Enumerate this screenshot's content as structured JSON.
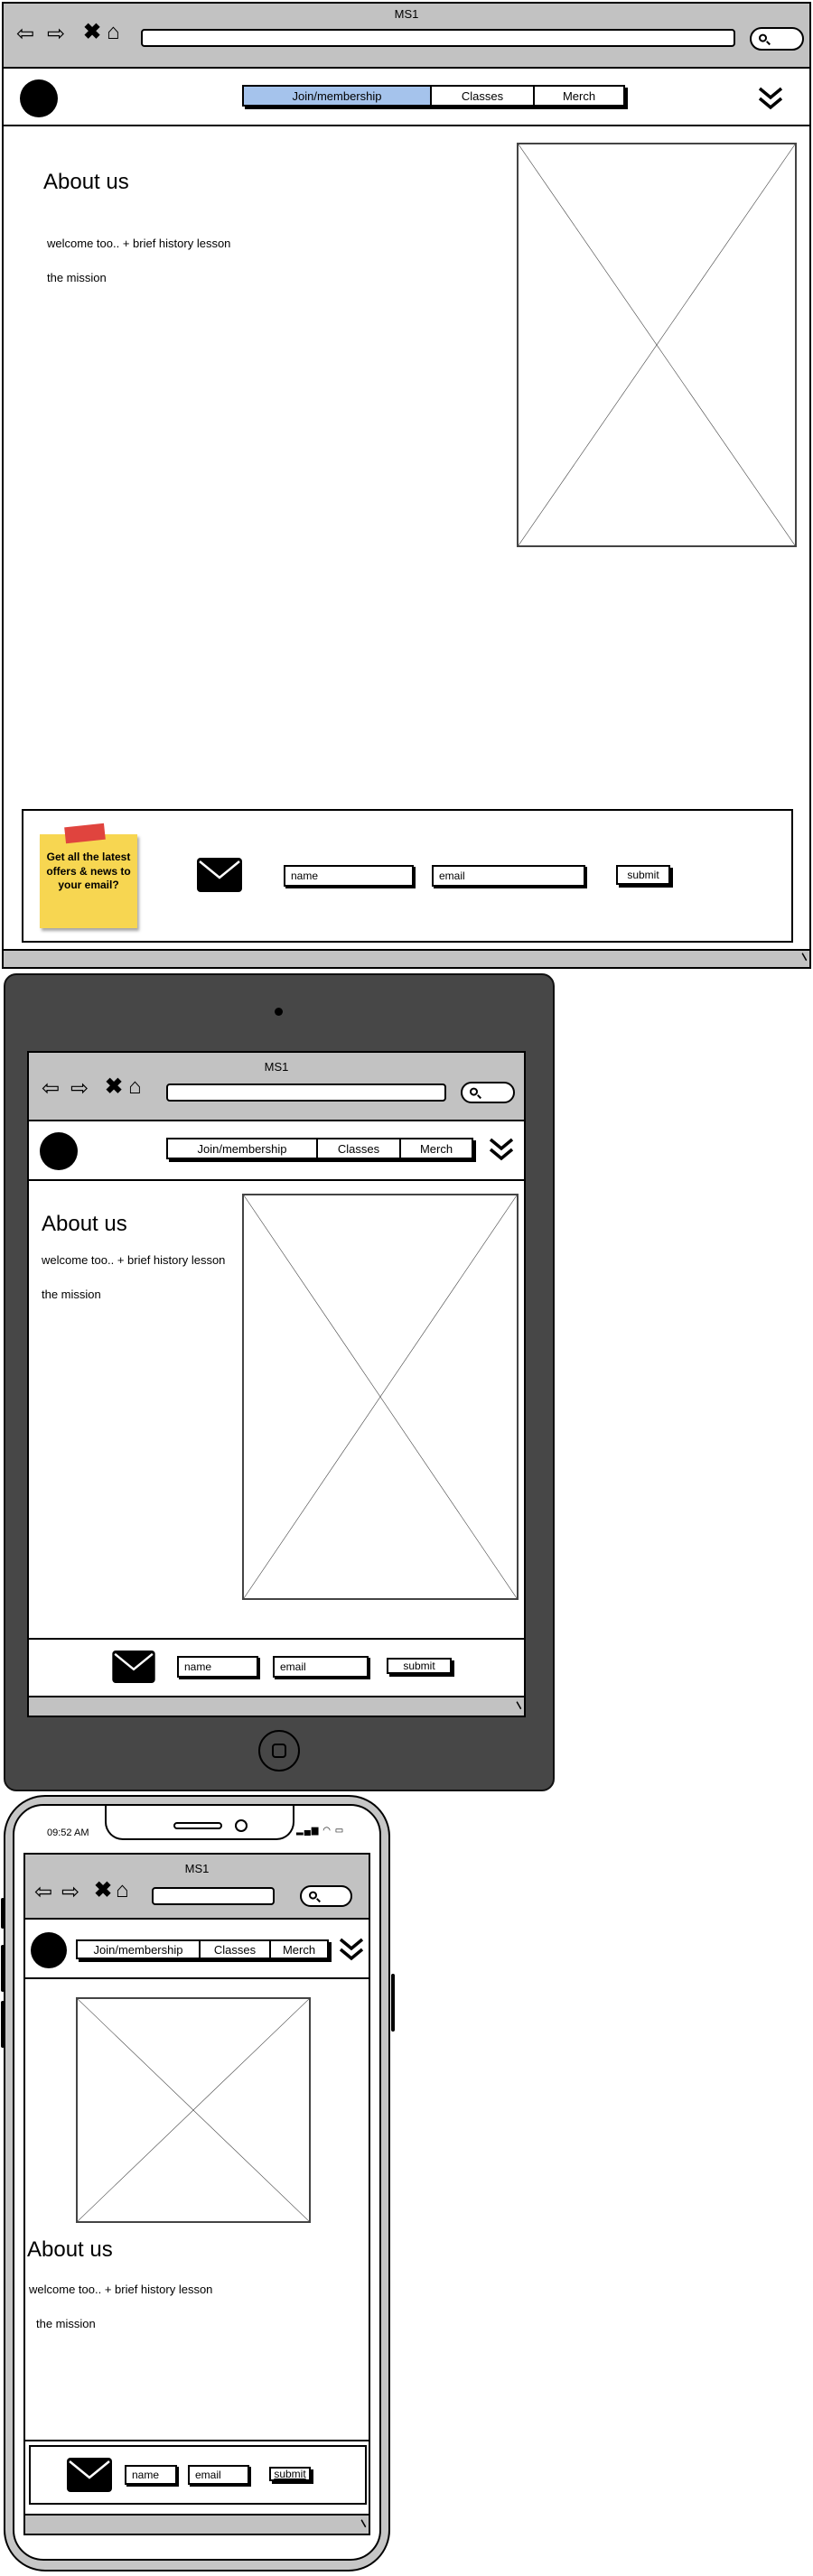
{
  "window_title": "MS1",
  "nav": {
    "tabs": [
      "Join/membership",
      "Classes",
      "Merch"
    ],
    "active_tab": "Join/membership"
  },
  "about": {
    "heading": "About us",
    "intro": "welcome too.. + brief history lesson",
    "mission": "the mission"
  },
  "newsletter": {
    "sticky_note": "Get all the latest offers & news to your email?",
    "name_field": "name",
    "email_field": "email",
    "submit_label": "submit"
  },
  "phone_status": {
    "time": "09:52 AM"
  },
  "colors": {
    "active_tab": "#a5c3ec",
    "chrome_grey": "#c2c2c2",
    "tablet_body": "#474747",
    "sticky_note": "#f7d651",
    "sticky_tape": "#e0443e"
  },
  "icons": [
    "back-arrow-icon",
    "forward-arrow-icon",
    "close-icon",
    "home-icon",
    "search-icon",
    "double-chevron-down-icon",
    "envelope-icon",
    "resize-grip-icon"
  ]
}
